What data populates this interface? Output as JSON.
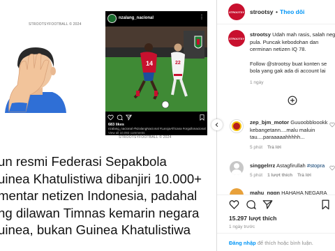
{
  "post_image": {
    "watermark_top": "STROOTSYFOOTBALL © 2024",
    "watermark_bottom": "STROOTSYFOOTBALL © 2024",
    "embedded_ig": {
      "username": "nzalang_nacional",
      "likes": "683 likes",
      "caption": "nzalang_nacional #NzalangNacional #LarojaAfricana #orgullonacional",
      "comments_link": "View all 10.093 comments"
    },
    "headline_lines": [
      "un resmi Federasi Sepakbola",
      "uinea Khatulistiwa dibanjiri 10.000+",
      "mentar netizen Indonesia, padahal",
      "ng dilawan Timnas kemarin negara",
      "uinea, bukan Guinea Khatulistiwa"
    ]
  },
  "header": {
    "username": "strootsy",
    "dot": "•",
    "follow_label": "Theo dõi",
    "avatar_text": "STROOTSY"
  },
  "caption": {
    "username": "strootsy",
    "text_p1": "Udah mah rasis, salah neg pula. Puncak kebodohan dan cerminan netizen IQ 78.",
    "text_p1_line1": " Udah mah rasis, salah neg",
    "text_p1_line2": "pula. Puncak kebodohan dan",
    "text_p1_line3": "cerminan netizen IQ 78.",
    "text_p2_line1": "Follow @strootsy buat konten se",
    "text_p2_line2": "bola yang gak ada di account lai",
    "time": "1 ngày"
  },
  "comments": [
    {
      "username": "zep_bjm_motor",
      "line1": " Guuoobbloookk",
      "line2": "kebangetann....malu maluin",
      "line3": "tau....paraaaaahhhhh...",
      "time": "5 phút",
      "reply_label": "Trả lời"
    },
    {
      "username": "singgelrrz",
      "text": " Astagfirullah ",
      "hashtag": "#stopra",
      "time": "5 phút",
      "likes": "1 lượt thích",
      "reply_label": "Trả lời"
    },
    {
      "username": "mahu_nggn",
      "text": " HAHAHA NEGARA"
    }
  ],
  "footer": {
    "likes": "15.297 lượt thích",
    "date": "1 ngày trước",
    "login_link": "Đăng nhập",
    "login_rest": " để thích hoặc bình luận."
  }
}
